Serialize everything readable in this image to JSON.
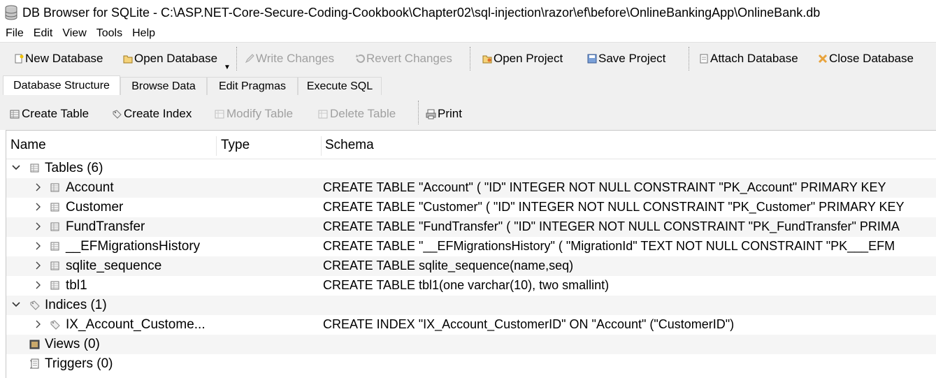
{
  "window": {
    "title": "DB Browser for SQLite - C:\\ASP.NET-Core-Secure-Coding-Cookbook\\Chapter02\\sql-injection\\razor\\ef\\before\\OnlineBankingApp\\OnlineBank.db",
    "icon": "database-icon"
  },
  "menu": [
    "File",
    "Edit",
    "View",
    "Tools",
    "Help"
  ],
  "toolbar": {
    "new_database": "New Database",
    "open_database": "Open Database",
    "write_changes": "Write Changes",
    "revert_changes": "Revert Changes",
    "open_project": "Open Project",
    "save_project": "Save Project",
    "attach_database": "Attach Database",
    "close_database": "Close Database"
  },
  "tabs": [
    "Database Structure",
    "Browse Data",
    "Edit Pragmas",
    "Execute SQL"
  ],
  "structure_toolbar": {
    "create_table": "Create Table",
    "create_index": "Create Index",
    "modify_table": "Modify Table",
    "delete_table": "Delete Table",
    "print": "Print"
  },
  "tree": {
    "columns": [
      "Name",
      "Type",
      "Schema"
    ],
    "tables_group": "Tables (6)",
    "tables": [
      {
        "name": "Account",
        "schema": "CREATE TABLE \"Account\" ( \"ID\" INTEGER NOT NULL CONSTRAINT \"PK_Account\" PRIMARY KEY"
      },
      {
        "name": "Customer",
        "schema": "CREATE TABLE \"Customer\" ( \"ID\" INTEGER NOT NULL CONSTRAINT \"PK_Customer\" PRIMARY KEY"
      },
      {
        "name": "FundTransfer",
        "schema": "CREATE TABLE \"FundTransfer\" ( \"ID\" INTEGER NOT NULL CONSTRAINT \"PK_FundTransfer\" PRIMA"
      },
      {
        "name": "__EFMigrationsHistory",
        "schema": "CREATE TABLE \"__EFMigrationsHistory\" ( \"MigrationId\" TEXT NOT NULL CONSTRAINT \"PK___EFM"
      },
      {
        "name": "sqlite_sequence",
        "schema": "CREATE TABLE sqlite_sequence(name,seq)"
      },
      {
        "name": "tbl1",
        "schema": "CREATE TABLE tbl1(one varchar(10), two smallint)"
      }
    ],
    "indices_group": "Indices (1)",
    "indices": [
      {
        "name": "IX_Account_Custome...",
        "schema": "CREATE INDEX \"IX_Account_CustomerID\" ON \"Account\" (\"CustomerID\")"
      }
    ],
    "views_group": "Views (0)",
    "triggers_group": "Triggers (0)"
  },
  "colors": {
    "chrome": "#f0f0f0",
    "alt_row": "#f5f5f5",
    "disabled_text": "#a0a0a0",
    "close_x": "#e8a33c"
  }
}
